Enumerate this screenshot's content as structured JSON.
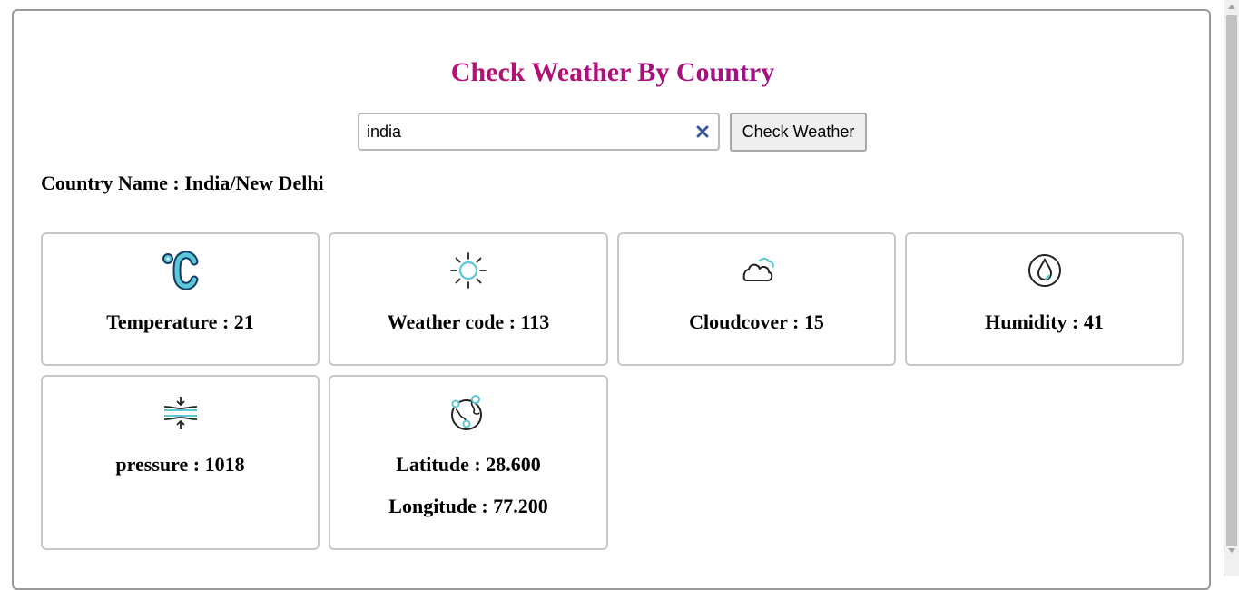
{
  "page": {
    "title": "Check Weather By Country"
  },
  "search": {
    "value": "india",
    "button_label": "Check Weather"
  },
  "result": {
    "country_line": "Country Name : India/New Delhi"
  },
  "cards": {
    "temperature": {
      "label": "Temperature : 21",
      "icon": "celsius-icon"
    },
    "weather_code": {
      "label": "Weather code : 113",
      "icon": "sun-icon"
    },
    "cloudcover": {
      "label": "Cloudcover : 15",
      "icon": "cloud-icon"
    },
    "humidity": {
      "label": "Humidity : 41",
      "icon": "water-drop-icon"
    },
    "pressure": {
      "label": "pressure : 1018",
      "icon": "pressure-icon"
    },
    "location": {
      "latitude": "Latitude : 28.600",
      "longitude": "Longitude : 77.200",
      "icon": "globe-icon"
    }
  },
  "colors": {
    "title_gradient_start": "#d6145a",
    "title_gradient_end": "#6a1aa8",
    "icon_accent": "#5bc8d6",
    "clear_icon": "#3a5a9a"
  }
}
